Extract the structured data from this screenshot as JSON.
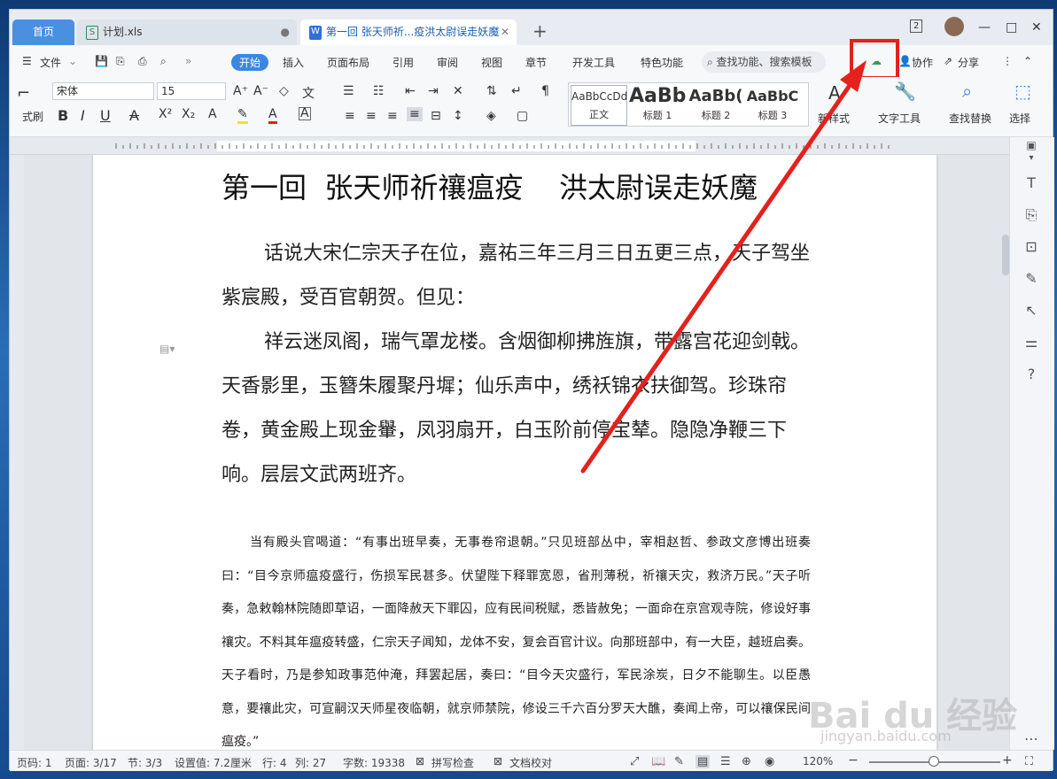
{
  "tabs": {
    "home": "首页",
    "file": "计划.xls",
    "doc": "第一回 张天师祈...疫洪太尉误走妖魔",
    "new_tab": "+"
  },
  "window": {
    "page_count_badge": "2",
    "minimize": "—",
    "maximize": "□",
    "close": "✕"
  },
  "menu": {
    "file": "文件",
    "items": [
      "开始",
      "插入",
      "页面布局",
      "引用",
      "审阅",
      "视图",
      "章节",
      "开发工具",
      "特色功能"
    ],
    "search": "查找功能、搜索模板",
    "collab": "协作",
    "share": "分享"
  },
  "ribbon": {
    "font_name": "宋体",
    "font_size": "15",
    "style_sample": "AaBbCcDd",
    "style_big": "AaBb",
    "style_big2": "AaBb(",
    "style_big3": "AaBbC",
    "styles": [
      "正文",
      "标题 1",
      "标题 2",
      "标题 3"
    ],
    "new_style": "新样式",
    "text_tools": "文字工具",
    "find_replace": "查找替换",
    "select": "选择",
    "left_cut": "式刷"
  },
  "document": {
    "title": "第一回  张天师祈禳瘟疫    洪太尉误走妖魔",
    "lines_big": [
      "话说大宋仁宗天子在位，嘉祐三年三月三日五更三点，天子",
      "驾坐紫宸殿，受百官朝贺。但见：",
      "祥云迷凤阁，瑞气罩龙楼。含烟御柳拂旌旗，带露宫花迎剑",
      "戟。天香影里，玉簪朱履聚丹墀；仙乐声中，绣袄锦衣扶御驾。",
      "珍珠帘卷，黄金殿上现金轝，凤羽扇开，白玉阶前停宝辇。隐隐",
      "净鞭三下响。层层文武两班齐。"
    ],
    "lines_small": [
      "当有殿头官喝道：“有事出班早奏，无事卷帘退朝。”只见班部丛中，宰相赵哲、参政文",
      "彦博出班奏曰：“目今京师瘟疫盛行，伤损军民甚多。伏望陛下释罪宽恩，省刑薄税，祈禳",
      "天灾，救济万民。”天子听奏，急敕翰林院随即草诏，一面降赦天下罪囚，应有民间税赋，",
      "悉皆赦免；一面命在京宫观寺院，修设好事禳灾。不料其年瘟疫转盛，仁宗天子闻知，龙体",
      "不安，复会百官计议。向那班部中，有一大臣，越班启奏。天子看时，乃是参知政事范仲淹，",
      "拜罢起居，奏曰：“目今天灾盛行，军民涂炭，日夕不能聊生。以臣愚意，要禳此灾，可宣",
      "嗣汉天师星夜临朝，就京师禁院，修设三千六百分罗天大醮，奏闻上帝，可以禳保民间瘟疫。”"
    ]
  },
  "status": {
    "page_num": "页码: 1",
    "pages": "页面: 3/17",
    "section": "节: 3/3",
    "setting": "设置值: 7.2厘米",
    "row": "行: 4",
    "col": "列: 27",
    "words": "字数: 19338",
    "spell": "拼写检查",
    "proof": "文档校对",
    "zoom": "120%"
  },
  "watermark": {
    "brand": "Bai du 经验",
    "url": "jingyan.baidu.com"
  },
  "colors": {
    "accent": "#3b86e3",
    "highlight": "#e4211c"
  }
}
